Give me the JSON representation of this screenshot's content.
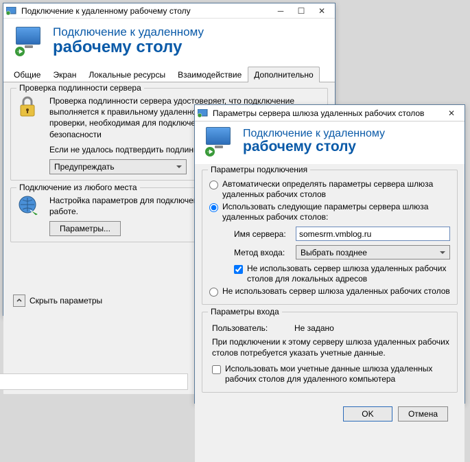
{
  "win1": {
    "title": "Подключение к удаленному рабочему столу",
    "header_line1": "Подключение к удаленному",
    "header_line2": "рабочему столу",
    "tabs": [
      "Общие",
      "Экран",
      "Локальные ресурсы",
      "Взаимодействие",
      "Дополнительно"
    ],
    "active_tab": 4,
    "auth": {
      "legend": "Проверка подлинности сервера",
      "text1": "Проверка подлинности сервера удостоверяет, что подключение выполняется к правильному удаленному компьютеру. Строгость проверки, необходимая для подключения, определяется политикой безопасности",
      "text2": "Если не удалось подтвердить подлинность удаленного компьютера:",
      "combo": "Предупреждать"
    },
    "anywhere": {
      "legend": "Подключение из любого места",
      "text": "Настройка параметров для подключения через шлюз при удаленной работе.",
      "button": "Параметры..."
    },
    "hide_params": "Скрыть параметры"
  },
  "win2": {
    "title": "Параметры сервера шлюза удаленных рабочих столов",
    "header_line1": "Подключение к удаленному",
    "header_line2": "рабочему столу",
    "conn": {
      "legend": "Параметры подключения",
      "opt1": "Автоматически определять параметры сервера шлюза удаленных рабочих столов",
      "opt2": "Использовать следующие параметры сервера шлюза удаленных рабочих столов:",
      "server_label": "Имя сервера:",
      "server_value": "somesrm.vmblog.ru",
      "method_label": "Метод входа:",
      "method_value": "Выбрать позднее",
      "chk_local": "Не использовать сервер шлюза удаленных рабочих столов для локальных адресов",
      "opt3": "Не использовать сервер шлюза удаленных рабочих столов"
    },
    "login": {
      "legend": "Параметры входа",
      "user_label": "Пользователь:",
      "user_value": "Не задано",
      "note": "При подключении к этому серверу шлюза удаленных рабочих столов потребуется указать учетные данные.",
      "chk_creds": "Использовать мои учетные данные шлюза удаленных рабочих столов для удаленного компьютера"
    },
    "ok": "OK",
    "cancel": "Отмена"
  }
}
